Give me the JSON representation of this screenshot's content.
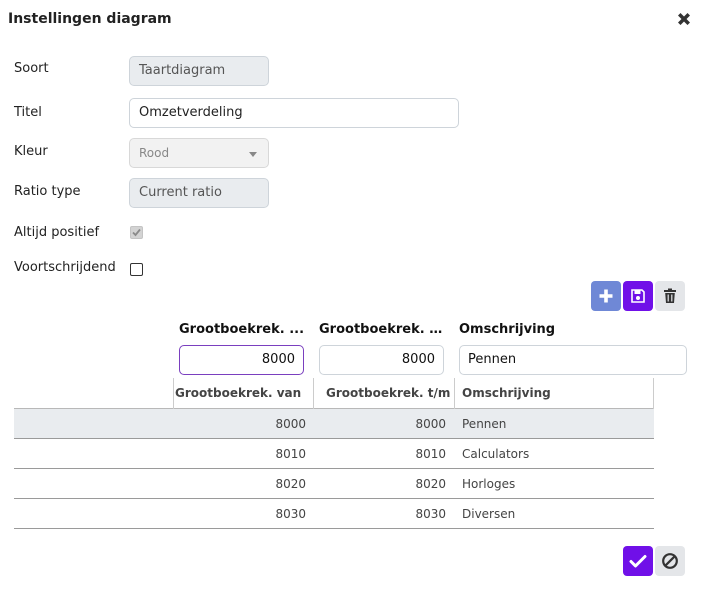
{
  "dialog": {
    "title": "Instellingen diagram"
  },
  "form": {
    "soort_label": "Soort",
    "soort_value": "Taartdiagram",
    "titel_label": "Titel",
    "titel_value": "Omzetverdeling",
    "kleur_label": "Kleur",
    "kleur_value": "Rood",
    "ratio_label": "Ratio type",
    "ratio_value": "Current ratio",
    "altijd_label": "Altijd positief",
    "altijd_checked": true,
    "voort_label": "Voortschrijdend",
    "voort_checked": false
  },
  "editor": {
    "col_van": "Grootboekrek. ...",
    "col_tm": "Grootboekrek. t...",
    "col_omschrijving": "Omschrijving",
    "van_value": "8000",
    "tm_value": "8000",
    "omschrijving_value": "Pennen"
  },
  "grid": {
    "headers": [
      "Grootboekrek. van",
      "Grootboekrek. t/m",
      "Omschrijving"
    ],
    "rows": [
      {
        "van": "8000",
        "tm": "8000",
        "omschrijving": "Pennen",
        "selected": true
      },
      {
        "van": "8010",
        "tm": "8010",
        "omschrijving": "Calculators",
        "selected": false
      },
      {
        "van": "8020",
        "tm": "8020",
        "omschrijving": "Horloges",
        "selected": false
      },
      {
        "van": "8030",
        "tm": "8030",
        "omschrijving": "Diversen",
        "selected": false
      }
    ]
  },
  "icons": {
    "close": "close-icon",
    "add": "plus-icon",
    "save": "floppy-disk-icon",
    "delete": "trash-icon",
    "confirm": "checkmark-icon",
    "cancel": "ban-icon"
  },
  "colors": {
    "accent": "#7010e8",
    "add_button": "#6f88d6",
    "selected_row": "#e9ecef"
  }
}
